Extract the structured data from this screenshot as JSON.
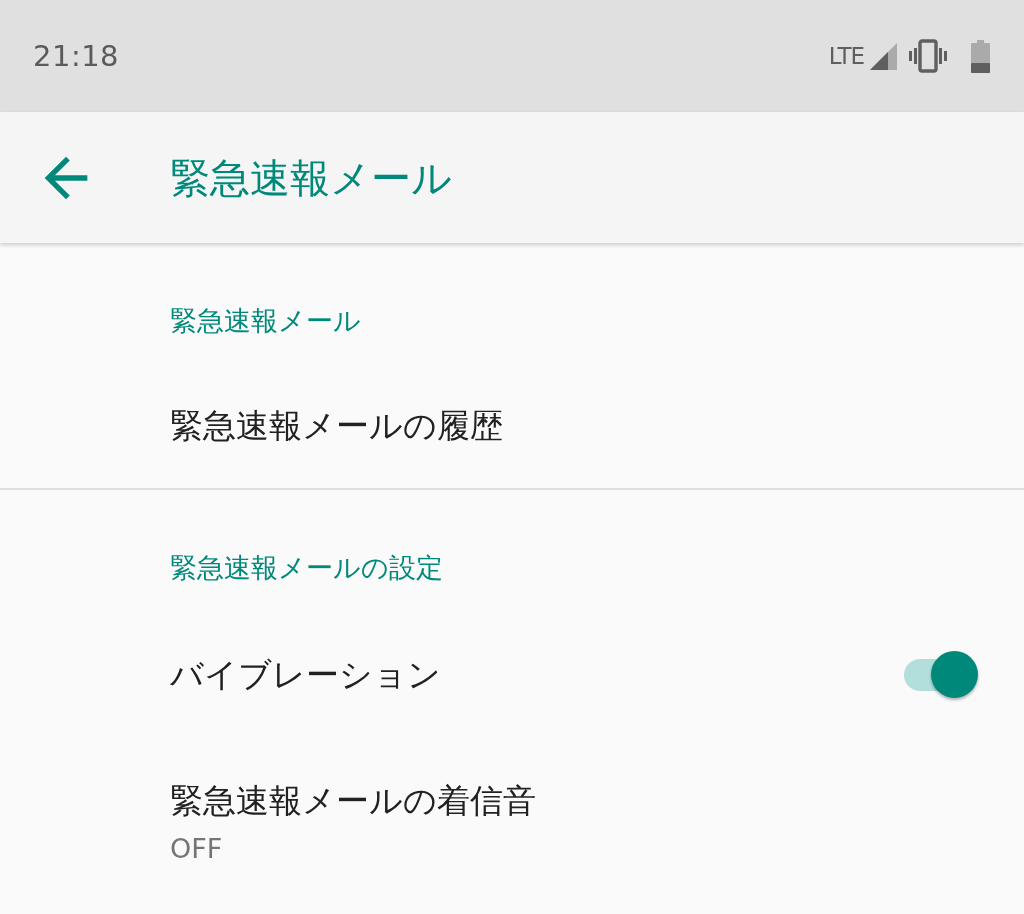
{
  "status_bar": {
    "time": "21:18",
    "network": "LTE"
  },
  "app_bar": {
    "title": "緊急速報メール"
  },
  "sections": [
    {
      "header": "緊急速報メール",
      "items": [
        {
          "kind": "link",
          "title": "緊急速報メールの履歴"
        }
      ]
    },
    {
      "header": "緊急速報メールの設定",
      "items": [
        {
          "kind": "switch",
          "title": "バイブレーション",
          "on": true
        },
        {
          "kind": "link",
          "title": "緊急速報メールの着信音",
          "summary": "OFF"
        }
      ]
    }
  ]
}
